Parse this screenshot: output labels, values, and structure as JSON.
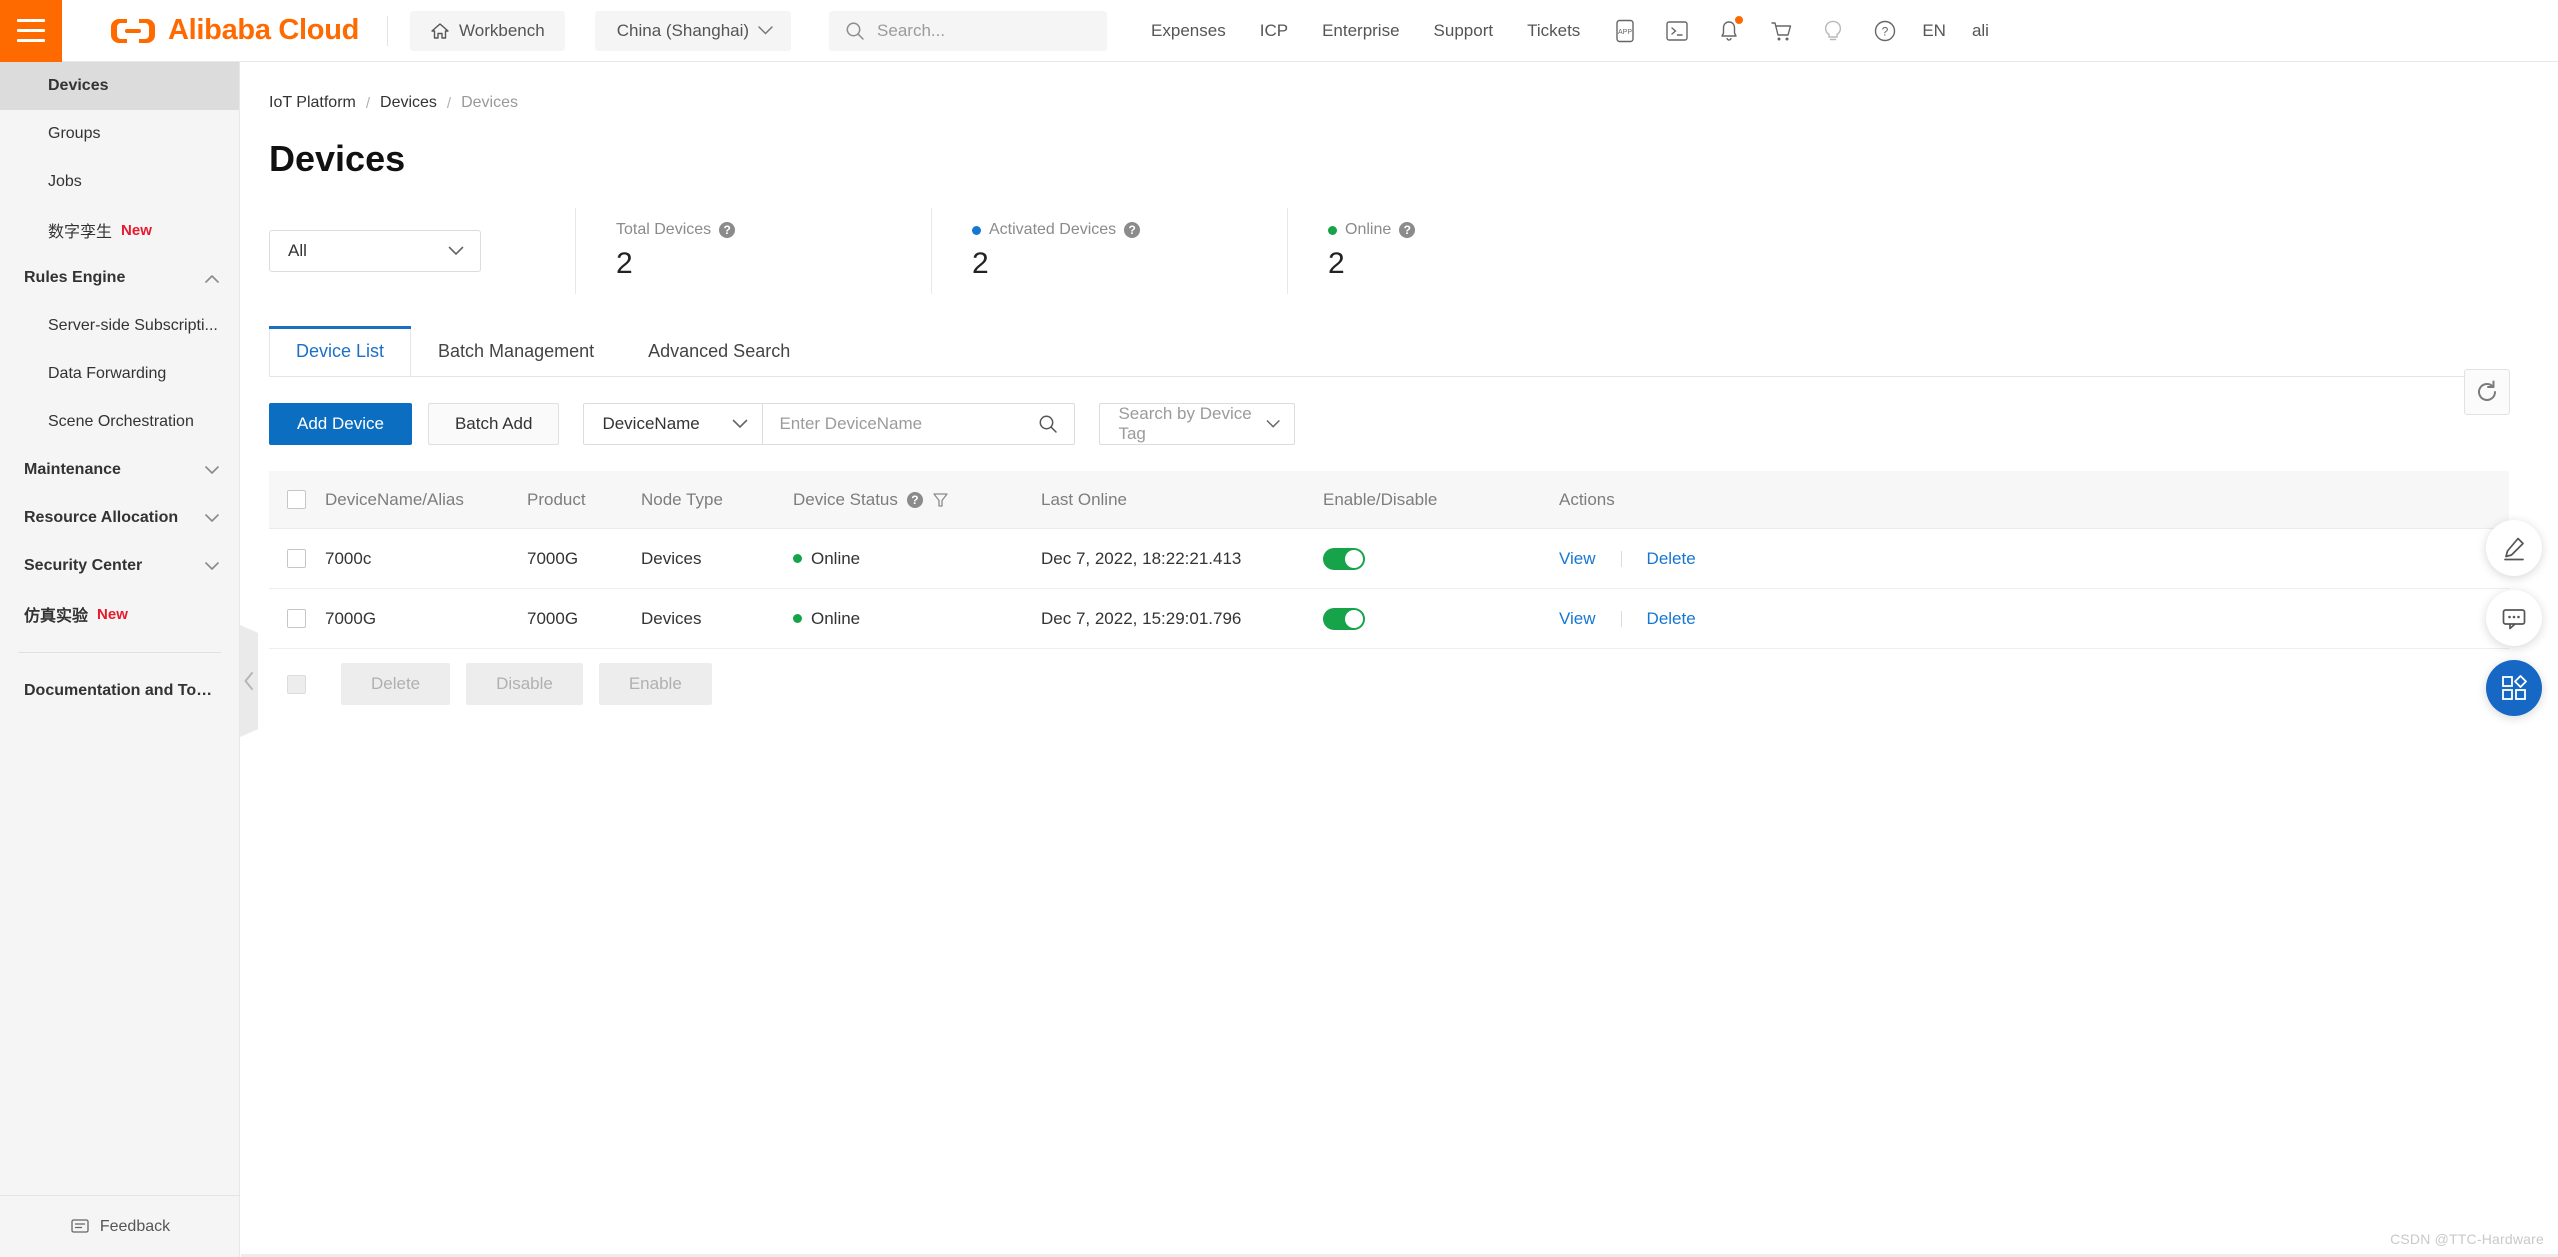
{
  "header": {
    "menu_icon": "hamburger-icon",
    "brand": "Alibaba Cloud",
    "workbench": "Workbench",
    "region": "China (Shanghai)",
    "search_placeholder": "Search...",
    "nav_links": [
      "Expenses",
      "ICP",
      "Enterprise",
      "Support",
      "Tickets"
    ],
    "icons": [
      "app-icon",
      "console-terminal-icon",
      "bell-icon",
      "cart-icon",
      "lightbulb-icon",
      "help-circle-icon"
    ],
    "language": "EN",
    "account": "ali"
  },
  "sidebar": {
    "items": [
      {
        "label": "Devices",
        "level": 2,
        "active": true,
        "tag": "",
        "chevron": ""
      },
      {
        "label": "Groups",
        "level": 2,
        "active": false,
        "tag": "",
        "chevron": ""
      },
      {
        "label": "Jobs",
        "level": 2,
        "active": false,
        "tag": "",
        "chevron": ""
      },
      {
        "label": "数字孪生",
        "level": 2,
        "active": false,
        "tag": "New",
        "chevron": ""
      },
      {
        "label": "Rules Engine",
        "level": 1,
        "active": false,
        "tag": "",
        "chevron": "up"
      },
      {
        "label": "Server-side Subscripti...",
        "level": 2,
        "active": false,
        "tag": "",
        "chevron": ""
      },
      {
        "label": "Data Forwarding",
        "level": 2,
        "active": false,
        "tag": "",
        "chevron": ""
      },
      {
        "label": "Scene Orchestration",
        "level": 2,
        "active": false,
        "tag": "",
        "chevron": ""
      },
      {
        "label": "Maintenance",
        "level": 1,
        "active": false,
        "tag": "",
        "chevron": "down"
      },
      {
        "label": "Resource Allocation",
        "level": 1,
        "active": false,
        "tag": "",
        "chevron": "down"
      },
      {
        "label": "Security Center",
        "level": 1,
        "active": false,
        "tag": "",
        "chevron": "down"
      },
      {
        "label": "仿真实验",
        "level": 1,
        "active": false,
        "tag": "New",
        "chevron": ""
      }
    ],
    "documentation": "Documentation and Tools",
    "feedback": "Feedback"
  },
  "breadcrumb": {
    "items": [
      "IoT Platform",
      "Devices"
    ],
    "current": "Devices",
    "separator": "/"
  },
  "page": {
    "title": "Devices"
  },
  "filter": {
    "value": "All"
  },
  "stats": [
    {
      "label": "Total Devices",
      "value": "2",
      "dot": ""
    },
    {
      "label": "Activated Devices",
      "value": "2",
      "dot": "#1677d2"
    },
    {
      "label": "Online",
      "value": "2",
      "dot": "#16a34a"
    }
  ],
  "refresh_icon": "refresh-icon",
  "tabs": [
    {
      "label": "Device List",
      "active": true
    },
    {
      "label": "Batch Management",
      "active": false
    },
    {
      "label": "Advanced Search",
      "active": false
    }
  ],
  "toolbar": {
    "add_device": "Add Device",
    "batch_add": "Batch Add",
    "field_select": "DeviceName",
    "search_placeholder": "Enter  DeviceName",
    "tag_select_placeholder": "Search by Device Tag"
  },
  "table": {
    "columns": [
      "DeviceName/Alias",
      "Product",
      "Node Type",
      "Device Status",
      "Last Online",
      "Enable/Disable",
      "Actions"
    ],
    "status_help_icon": "help-circle-icon",
    "status_filter_icon": "funnel-filter-icon",
    "rows": [
      {
        "name": "7000c",
        "product": "7000G",
        "node_type": "Devices",
        "status": "Online",
        "status_color": "#16a34a",
        "last_online": "Dec 7, 2022, 18:22:21.413",
        "enabled": true,
        "actions": [
          "View",
          "Delete"
        ]
      },
      {
        "name": "7000G",
        "product": "7000G",
        "node_type": "Devices",
        "status": "Online",
        "status_color": "#16a34a",
        "last_online": "Dec 7, 2022, 15:29:01.796",
        "enabled": true,
        "actions": [
          "View",
          "Delete"
        ]
      }
    ]
  },
  "batch_actions": [
    "Delete",
    "Disable",
    "Enable"
  ],
  "fabs": [
    "pencil-edit-icon",
    "chat-bubble-icon",
    "grid-apps-icon"
  ],
  "watermark": "CSDN @TTC-Hardware"
}
